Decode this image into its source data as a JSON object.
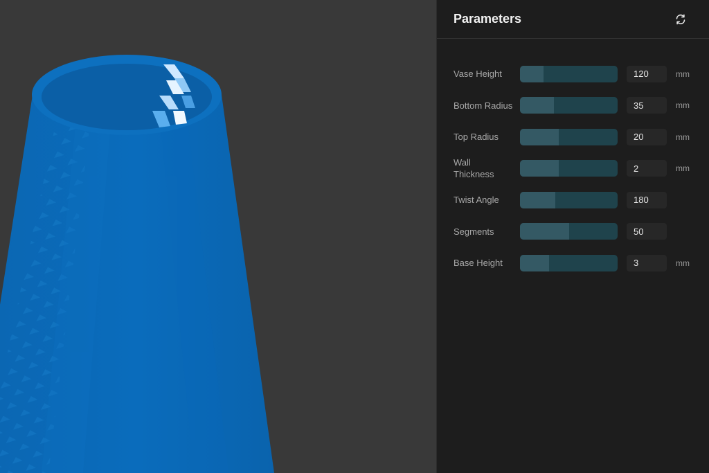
{
  "panel": {
    "title": "Parameters",
    "reset_icon": "refresh-icon"
  },
  "params": [
    {
      "label": "Vase Height",
      "value": "120",
      "unit": "mm",
      "fraction": 0.24
    },
    {
      "label": "Bottom Radius",
      "value": "35",
      "unit": "mm",
      "fraction": 0.35
    },
    {
      "label": "Top Radius",
      "value": "20",
      "unit": "mm",
      "fraction": 0.4
    },
    {
      "label": "Wall Thickness",
      "value": "2",
      "unit": "mm",
      "fraction": 0.4
    },
    {
      "label": "Twist Angle",
      "value": "180",
      "unit": "",
      "fraction": 0.36
    },
    {
      "label": "Segments",
      "value": "50",
      "unit": "",
      "fraction": 0.5
    },
    {
      "label": "Base Height",
      "value": "3",
      "unit": "mm",
      "fraction": 0.3
    }
  ],
  "colors": {
    "vase": "#0a69b7",
    "slider_track": "#1f434c",
    "slider_fill": "#345964",
    "viewport_bg": "#393939"
  }
}
